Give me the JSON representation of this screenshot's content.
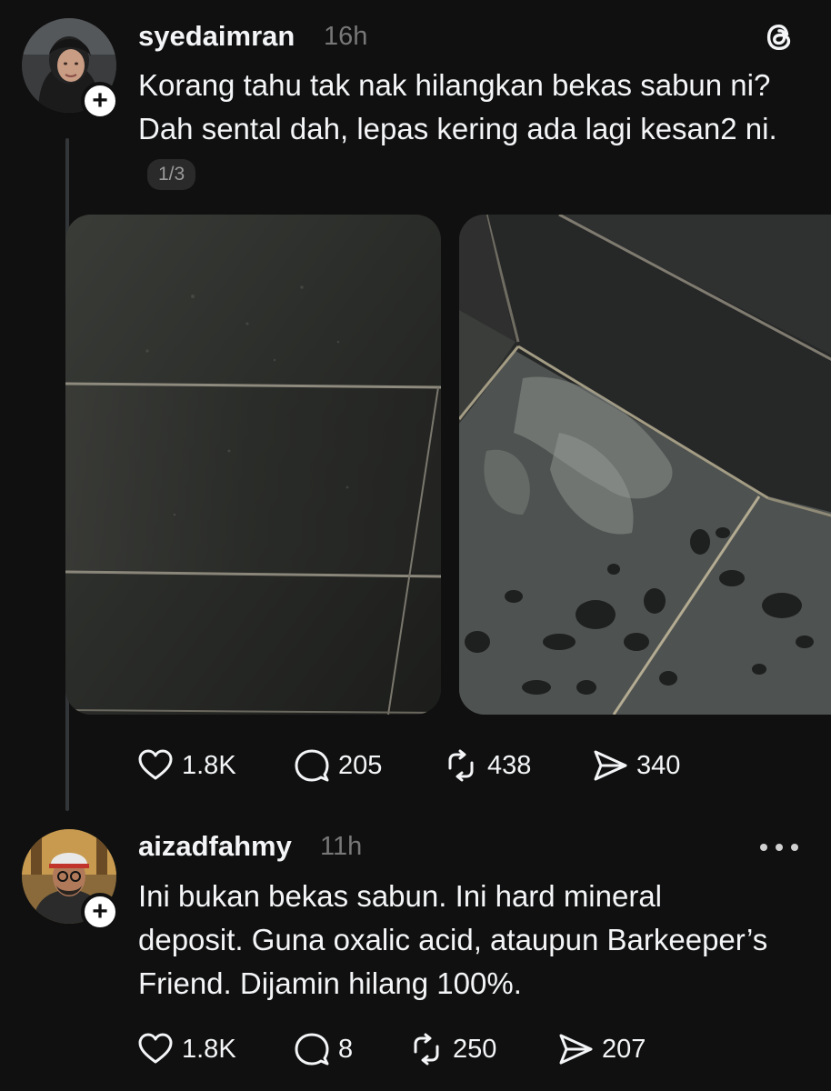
{
  "post1": {
    "username": "syedaimran",
    "time": "16h",
    "text": "Korang tahu tak nak hilangkan bekas sabun ni? Dah  sental dah, lepas kering ada lagi kesan2 ni.",
    "page_counter": "1/3",
    "likes": "1.8K",
    "replies": "205",
    "reposts": "438",
    "shares": "340"
  },
  "post2": {
    "username": "aizadfahmy",
    "time": "11h",
    "text": "Ini bukan bekas sabun. Ini hard mineral deposit. Guna oxalic acid, ataupun Barkeeper’s Friend. Dijamin hilang 100%.",
    "likes": "1.8K",
    "replies": "8",
    "reposts": "250",
    "shares": "207"
  },
  "icons": {
    "app_logo": "threads-logo-icon",
    "follow": "plus-icon",
    "like": "heart-icon",
    "reply": "comment-bubble-icon",
    "repost": "repost-icon",
    "share": "share-send-icon",
    "more": "more-horizontal-icon"
  },
  "colors": {
    "background": "#101010",
    "text_primary": "#f3f5f7",
    "text_secondary": "#777777",
    "thread_line": "#333638"
  }
}
